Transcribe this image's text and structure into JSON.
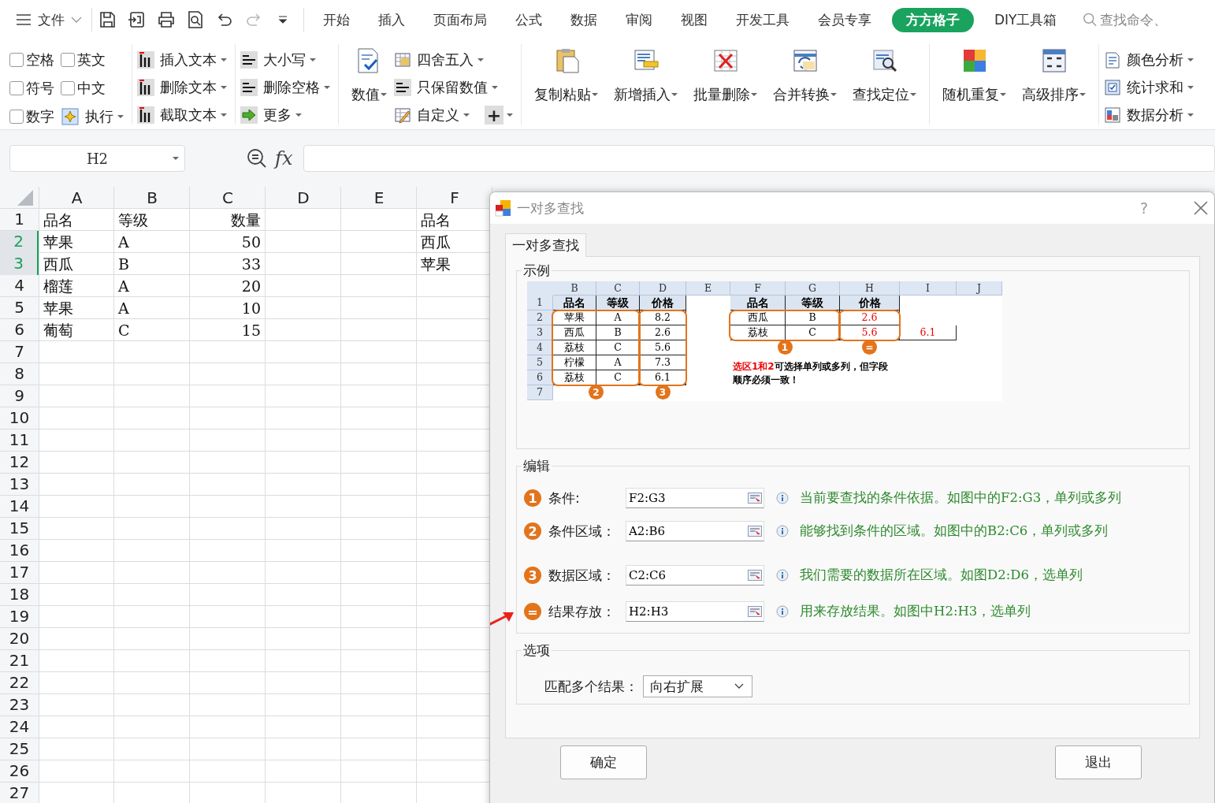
{
  "topbar": {
    "menu": "文件",
    "quick_access": [
      {
        "kind": "save",
        "disabled": false
      },
      {
        "kind": "export",
        "disabled": false
      },
      {
        "kind": "print",
        "disabled": false
      },
      {
        "kind": "preview",
        "disabled": false
      },
      {
        "kind": "undo",
        "disabled": false
      },
      {
        "kind": "redo",
        "disabled": true
      },
      {
        "kind": "customize",
        "disabled": false
      }
    ],
    "tabs": [
      {
        "label": "开始",
        "selected": false
      },
      {
        "label": "插入",
        "selected": false
      },
      {
        "label": "页面布局",
        "selected": false
      },
      {
        "label": "公式",
        "selected": false
      },
      {
        "label": "数据",
        "selected": false
      },
      {
        "label": "审阅",
        "selected": false
      },
      {
        "label": "视图",
        "selected": false
      },
      {
        "label": "开发工具",
        "selected": false
      },
      {
        "label": "会员专享",
        "selected": false
      },
      {
        "label": "方方格子",
        "selected": true
      },
      {
        "label": "DIY工具箱",
        "selected": false
      }
    ],
    "search": {
      "placeholder": "查找命令、"
    }
  },
  "ribbon": {
    "groups": [
      {
        "kind": "checks",
        "items": [
          {
            "label": "空格",
            "checked": false
          },
          {
            "label": "英文",
            "checked": false
          },
          {
            "label": "符号",
            "checked": false
          },
          {
            "label": "中文",
            "checked": false
          },
          {
            "label": "数字",
            "checked": false
          }
        ],
        "button": {
          "label": "执行"
        }
      },
      {
        "kind": "small",
        "items": [
          {
            "label": "插入文本"
          },
          {
            "label": "删除文本"
          },
          {
            "label": "截取文本"
          }
        ]
      },
      {
        "kind": "small",
        "items": [
          {
            "label": "大小写"
          },
          {
            "label": "删除空格"
          },
          {
            "label": "更多"
          }
        ]
      },
      {
        "kind": "mixed",
        "big": {
          "label": "数值"
        },
        "items": [
          {
            "label": "四舍五入"
          },
          {
            "label": "只保留数值"
          },
          {
            "label": "自定义"
          }
        ],
        "extra": {
          "label": "+"
        }
      },
      {
        "kind": "big",
        "items": [
          {
            "label": "复制粘贴"
          },
          {
            "label": "新增插入"
          },
          {
            "label": "批量删除"
          },
          {
            "label": "合并转换"
          },
          {
            "label": "查找定位"
          }
        ]
      },
      {
        "kind": "big",
        "items": [
          {
            "label": "随机重复"
          },
          {
            "label": "高级排序"
          }
        ]
      },
      {
        "kind": "small",
        "items": [
          {
            "label": "颜色分析"
          },
          {
            "label": "统计求和"
          },
          {
            "label": "数据分析"
          }
        ]
      }
    ]
  },
  "formula_bar": {
    "cell": "H2",
    "fx": "fx"
  },
  "sheet": {
    "columns": [
      {
        "label": "A",
        "kind": "text"
      },
      {
        "label": "B",
        "kind": "text"
      },
      {
        "label": "C",
        "kind": "number"
      },
      {
        "label": "D",
        "kind": "text"
      },
      {
        "label": "E",
        "kind": "text"
      },
      {
        "label": "F",
        "kind": "text"
      }
    ],
    "rows": [
      {
        "num": "1",
        "selected": false,
        "cells": {
          "A": "品名",
          "B": "等级",
          "C": "数量",
          "F": "品名"
        }
      },
      {
        "num": "2",
        "selected": true,
        "cells": {
          "A": "苹果",
          "B": "A",
          "C": "50",
          "F": "西瓜"
        }
      },
      {
        "num": "3",
        "selected": true,
        "cells": {
          "A": "西瓜",
          "B": "B",
          "C": "33",
          "F": "苹果"
        }
      },
      {
        "num": "4",
        "selected": false,
        "cells": {
          "A": "榴莲",
          "B": "A",
          "C": "20"
        }
      },
      {
        "num": "5",
        "selected": false,
        "cells": {
          "A": "苹果",
          "B": "A",
          "C": "10"
        }
      },
      {
        "num": "6",
        "selected": false,
        "cells": {
          "A": "葡萄",
          "B": "C",
          "C": "15"
        }
      },
      {
        "num": "7",
        "selected": false
      },
      {
        "num": "8",
        "selected": false
      },
      {
        "num": "9",
        "selected": false
      },
      {
        "num": "10",
        "selected": false
      },
      {
        "num": "11",
        "selected": false
      },
      {
        "num": "12",
        "selected": false
      },
      {
        "num": "13",
        "selected": false
      },
      {
        "num": "14",
        "selected": false
      },
      {
        "num": "15",
        "selected": false
      },
      {
        "num": "16",
        "selected": false
      },
      {
        "num": "17",
        "selected": false
      },
      {
        "num": "18",
        "selected": false
      },
      {
        "num": "19",
        "selected": false
      },
      {
        "num": "20",
        "selected": false
      },
      {
        "num": "21",
        "selected": false
      },
      {
        "num": "22",
        "selected": false
      },
      {
        "num": "23",
        "selected": false
      },
      {
        "num": "24",
        "selected": false
      },
      {
        "num": "25",
        "selected": false
      },
      {
        "num": "26",
        "selected": false
      },
      {
        "num": "27",
        "selected": false
      }
    ]
  },
  "dialog": {
    "title": "一对多查找",
    "help_button": "?",
    "tabs": [
      {
        "label": "一对多查找",
        "selected": true
      }
    ],
    "example": {
      "title": "示例",
      "columns": [
        {
          "label": "B",
          "kind": "plain"
        },
        {
          "label": "C",
          "kind": "plain"
        },
        {
          "label": "D",
          "kind": "plain"
        },
        {
          "label": "E",
          "kind": "plain"
        },
        {
          "label": "F",
          "kind": "plain"
        },
        {
          "label": "G",
          "kind": "plain"
        },
        {
          "label": "H",
          "kind": "result"
        },
        {
          "label": "I",
          "kind": "result"
        },
        {
          "label": "J",
          "kind": "plain"
        }
      ],
      "rows": [
        {
          "num": "1",
          "kind": "header",
          "cells": {
            "B": "品名",
            "C": "等级",
            "D": "价格",
            "F": "品名",
            "G": "等级",
            "H": "价格"
          }
        },
        {
          "num": "2",
          "kind": "data",
          "cells": {
            "B": "苹果",
            "C": "A",
            "D": "8.2",
            "F": "西瓜",
            "G": "B",
            "H": "2.6"
          }
        },
        {
          "num": "3",
          "kind": "data",
          "cells": {
            "B": "西瓜",
            "C": "B",
            "D": "2.6",
            "F": "荔枝",
            "G": "C",
            "H": "5.6",
            "I": "6.1"
          }
        },
        {
          "num": "4",
          "kind": "data",
          "cells": {
            "B": "荔枝",
            "C": "C",
            "D": "5.6"
          }
        },
        {
          "num": "5",
          "kind": "data",
          "cells": {
            "B": "柠檬",
            "C": "A",
            "D": "7.3"
          }
        },
        {
          "num": "6",
          "kind": "data",
          "cells": {
            "B": "荔枝",
            "C": "C",
            "D": "6.1"
          }
        },
        {
          "num": "7",
          "kind": "data"
        }
      ],
      "ranges": [
        {
          "badge": "2"
        },
        {
          "badge": "3"
        },
        {
          "badge": "1"
        },
        {
          "badge": "="
        }
      ],
      "note": {
        "highlight": "选区1和2",
        "text": "可选择单列或多列，但字段顺序必须一致！"
      }
    },
    "edit": {
      "title": "编辑",
      "rows": [
        {
          "badge": "1",
          "label": "条件:",
          "value": "F2:G3",
          "help": "当前要查找的条件依据。如图中的F2:G3，单列或多列",
          "pointer": false
        },
        {
          "badge": "2",
          "label": "条件区域：",
          "value": "A2:B6",
          "help": "能够找到条件的区域。如图中的B2:C6，单列或多列",
          "pointer": false
        },
        {
          "badge": "3",
          "label": "数据区域：",
          "value": "C2:C6",
          "help": "我们需要的数据所在区域。如图D2:D6，选单列",
          "pointer": false
        },
        {
          "badge": "=",
          "label": "结果存放：",
          "value": "H2:H3",
          "help": "用来存放结果。如图中H2:H3，选单列",
          "pointer": true
        }
      ]
    },
    "options": {
      "title": "选项",
      "label": "匹配多个结果：",
      "value": "向右扩展"
    },
    "buttons": [
      {
        "label": "确定"
      },
      {
        "label": "退出"
      }
    ]
  }
}
